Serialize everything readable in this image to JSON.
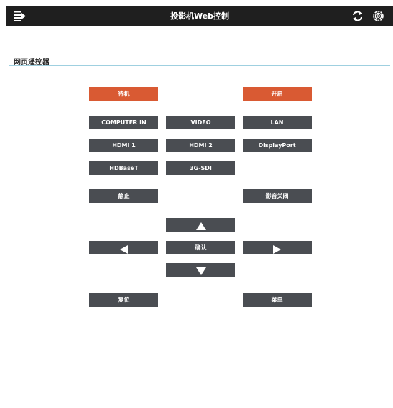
{
  "header": {
    "title": "投影机Web控制",
    "icons": [
      "menu-icon",
      "refresh-icon",
      "gear-icon"
    ]
  },
  "section": {
    "title": "网页遥控器"
  },
  "colors": {
    "accent": "#d95a33",
    "button": "#4a4d52",
    "topbar": "#1f1f1f",
    "divider": "#9fd0e0"
  },
  "buttons": {
    "standby": "待机",
    "power_on": "开启",
    "computer_in": "COMPUTER IN",
    "video": "VIDEO",
    "lan": "LAN",
    "hdmi1": "HDMI 1",
    "hdmi2": "HDMI 2",
    "displayport": "DisplayPort",
    "hdbaset": "HDBaseT",
    "sdi": "3G-SDI",
    "freeze": "静止",
    "av_mute": "影音关闭",
    "up": "up-arrow-icon",
    "left": "left-arrow-icon",
    "enter": "确认",
    "right": "right-arrow-icon",
    "down": "down-arrow-icon",
    "reset": "复位",
    "menu": "菜单"
  }
}
